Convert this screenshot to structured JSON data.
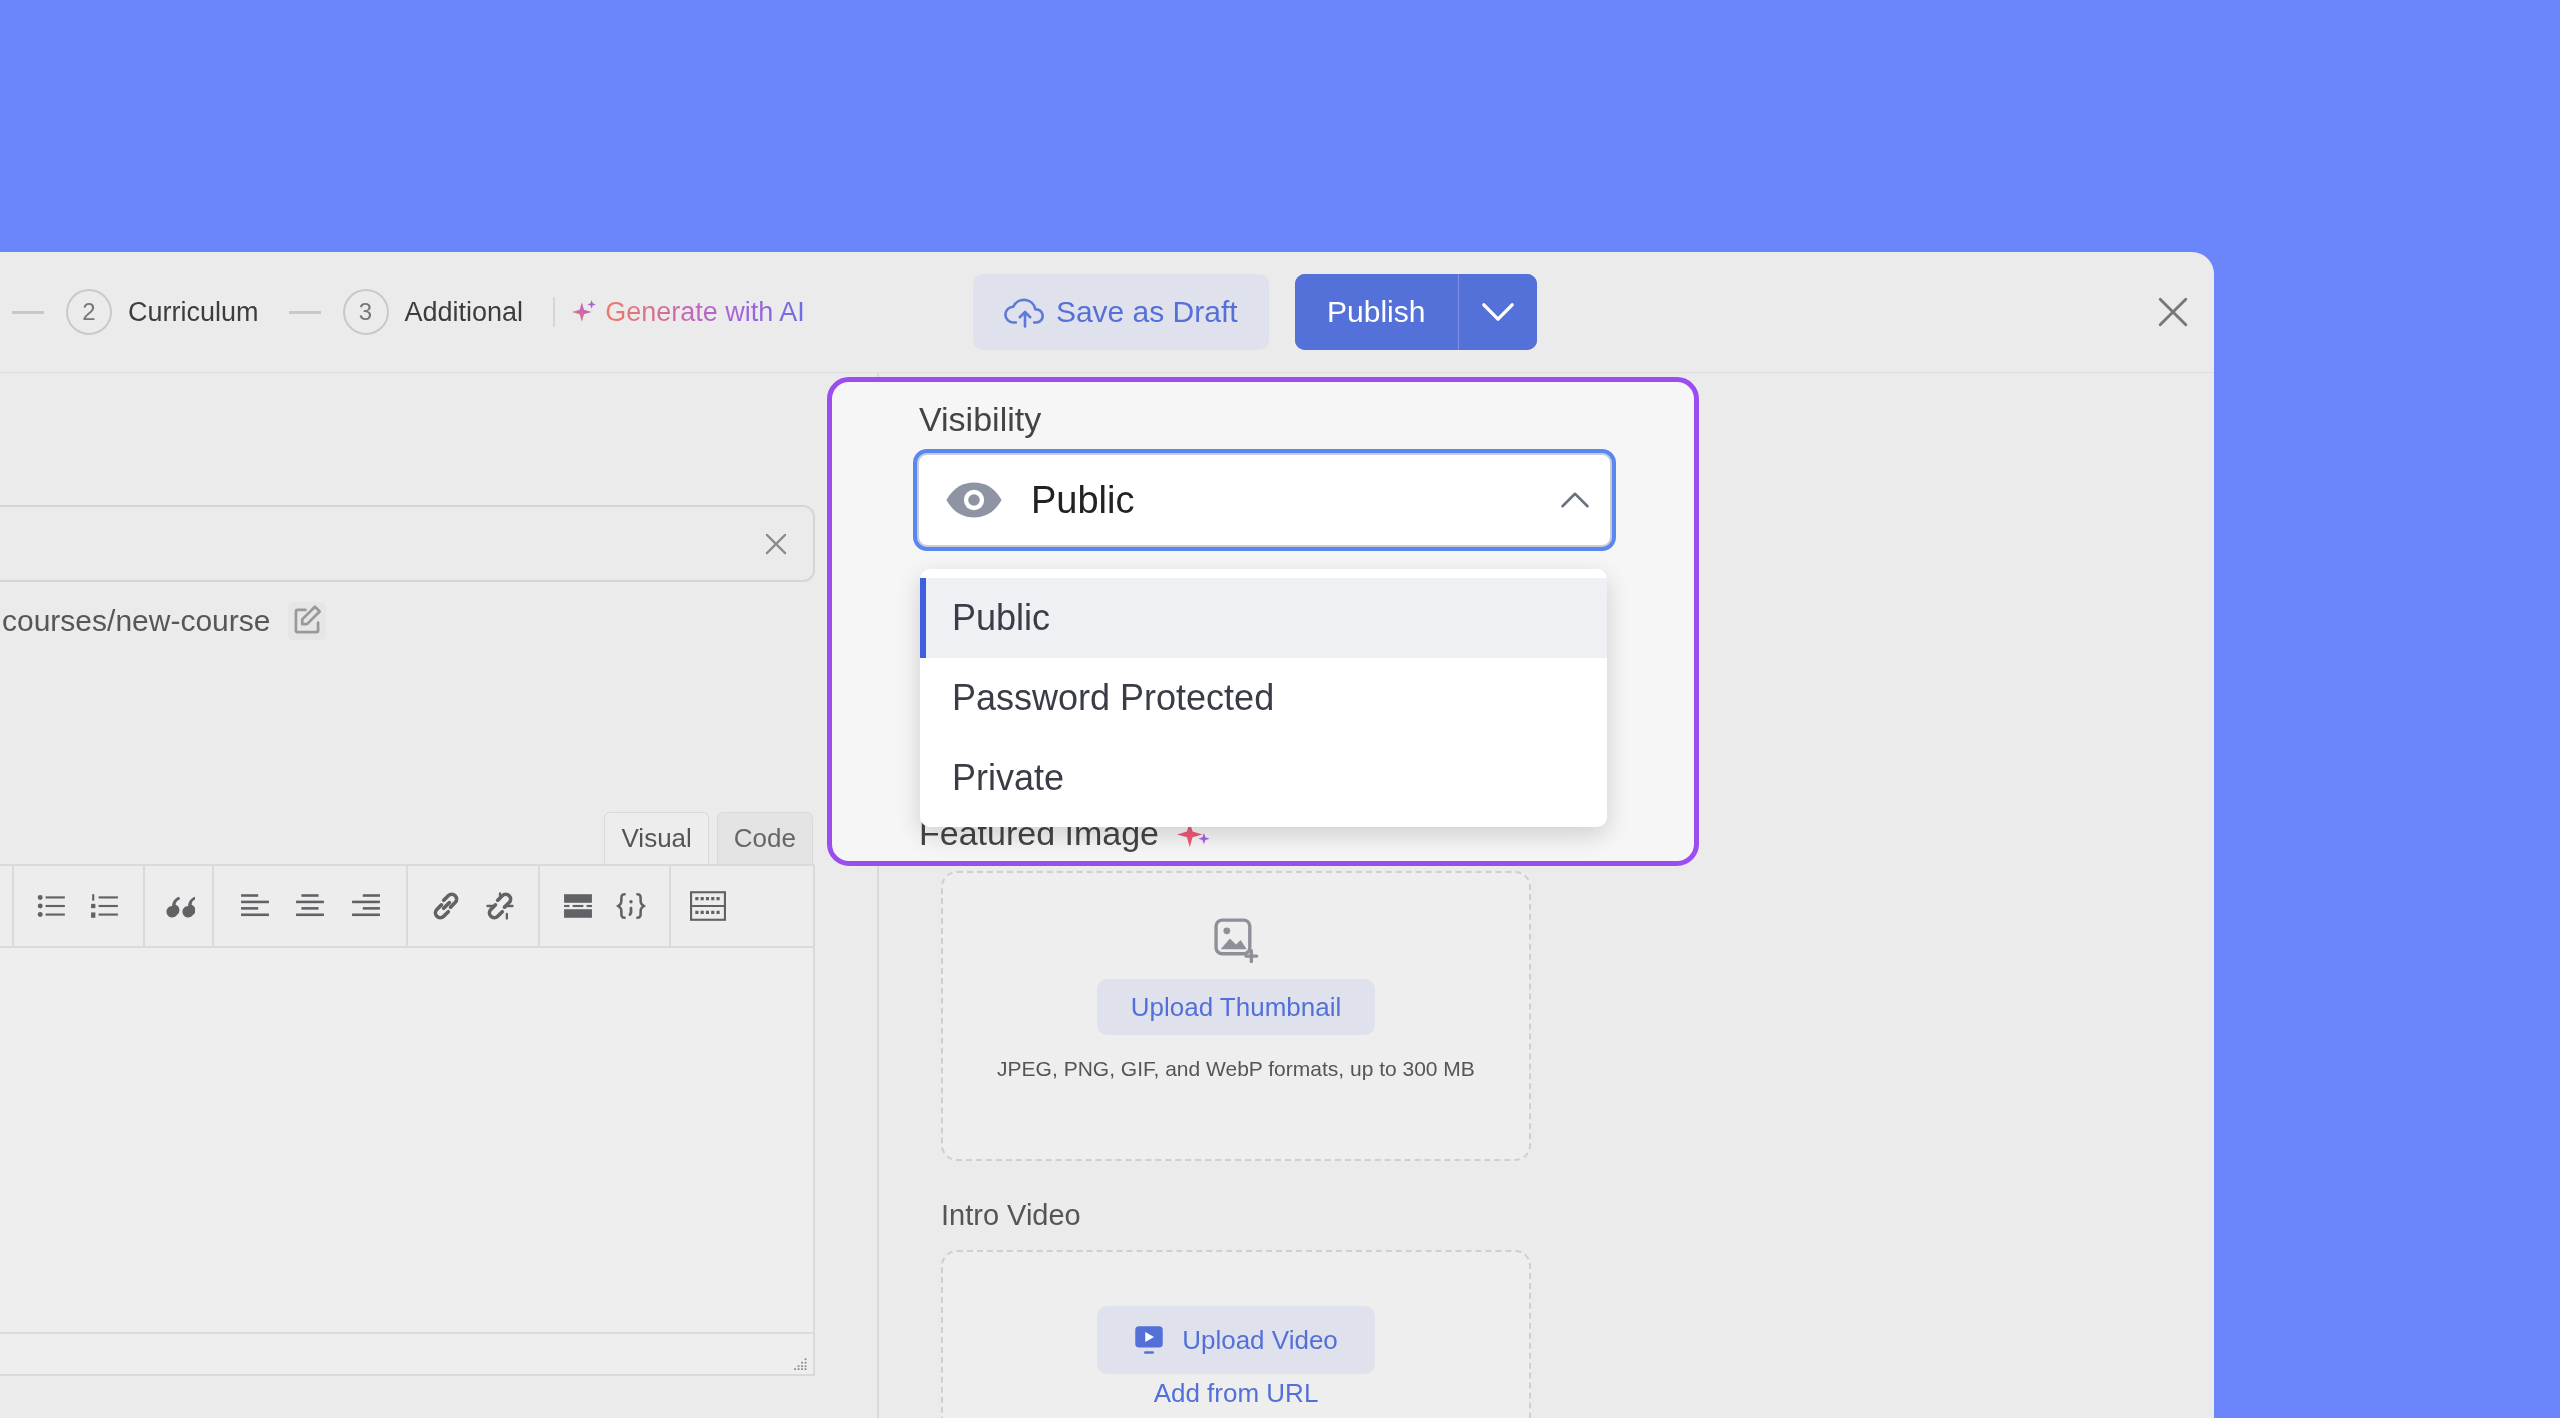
{
  "steps": [
    {
      "number": "2",
      "label": "Curriculum"
    },
    {
      "number": "3",
      "label": "Additional"
    }
  ],
  "ai_button": "Generate with AI",
  "save_draft": "Save as Draft",
  "publish": "Publish",
  "url": "courses/new-course",
  "editor_tabs": [
    {
      "label": "Visual",
      "selected": true
    },
    {
      "label": "Code",
      "selected": false
    }
  ],
  "visibility": {
    "label": "Visibility",
    "value": "Public",
    "expanded": true,
    "options": [
      {
        "label": "Public",
        "selected": true
      },
      {
        "label": "Password Protected",
        "selected": false
      },
      {
        "label": "Private",
        "selected": false
      }
    ]
  },
  "featured_image": {
    "label": "Featured Image",
    "button": "Upload Thumbnail",
    "hint": "JPEG, PNG, GIF, and WebP formats, up to 300 MB"
  },
  "intro_video": {
    "label": "Intro Video",
    "button": "Upload Video",
    "link": "Add from URL"
  }
}
